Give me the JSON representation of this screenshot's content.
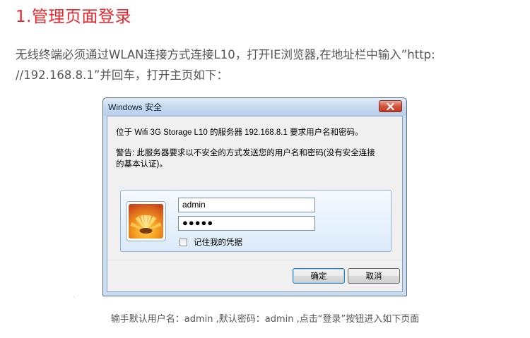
{
  "heading": "1.管理页面登录",
  "intro": {
    "line1": "无线终端必须通过WLAN连接方式连接L10，打开IE浏览器,在地址栏中输入”http:",
    "line2": "//192.168.8.1”并回车，打开主页如下："
  },
  "dialog": {
    "title": "Windows 安全",
    "message": "位于 Wifi 3G Storage L10 的服务器 192.168.8.1 要求用户名和密码。",
    "warning_line1": "警告: 此服务器要求以不安全的方式发送您的用户名和密码(没有安全连接",
    "warning_line2": "的基本认证)。",
    "username_value": "admin",
    "password_value": "●●●●●",
    "remember_label": "记住我的凭据",
    "ok_label": "确定",
    "cancel_label": "取消",
    "icons": {
      "close": "close-icon",
      "avatar": "user-avatar-flower-icon"
    },
    "colors": {
      "close_button": "#c94a33",
      "ok_border": "#3c7fb1"
    }
  },
  "caption": "输手默认用户名：admin ,默认密码：admin ,点击“登录”按钮进入如下页面",
  "colors": {
    "heading": "#e8262b",
    "body_text": "#555555"
  }
}
